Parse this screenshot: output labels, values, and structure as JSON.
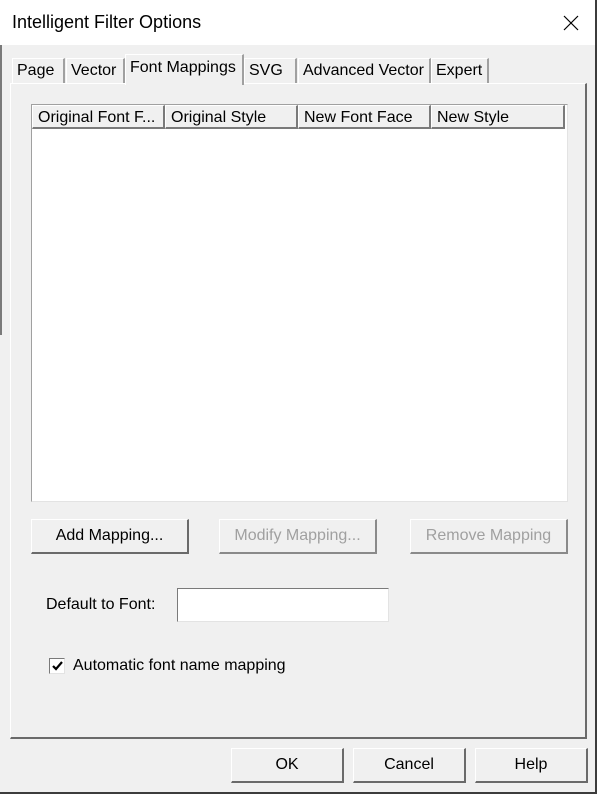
{
  "window": {
    "title": "Intelligent Filter Options",
    "close_icon": "close-icon"
  },
  "tabs": [
    {
      "label": "Page",
      "active": false
    },
    {
      "label": "Vector",
      "active": false
    },
    {
      "label": "Font Mappings",
      "active": true
    },
    {
      "label": "SVG",
      "active": false
    },
    {
      "label": "Advanced Vector",
      "active": false
    },
    {
      "label": "Expert",
      "active": false
    }
  ],
  "font_mappings": {
    "list": {
      "columns": [
        "Original Font F...",
        "Original Style",
        "New Font Face",
        "New Style"
      ],
      "rows": []
    },
    "add_mapping_label": "Add Mapping...",
    "modify_mapping_label": "Modify Mapping...",
    "remove_mapping_label": "Remove Mapping",
    "modify_mapping_enabled": false,
    "remove_mapping_enabled": false,
    "default_font_label": "Default to Font:",
    "default_font_value": "",
    "auto_mapping_label": "Automatic font name mapping",
    "auto_mapping_checked": true
  },
  "footer": {
    "ok_label": "OK",
    "cancel_label": "Cancel",
    "help_label": "Help"
  }
}
